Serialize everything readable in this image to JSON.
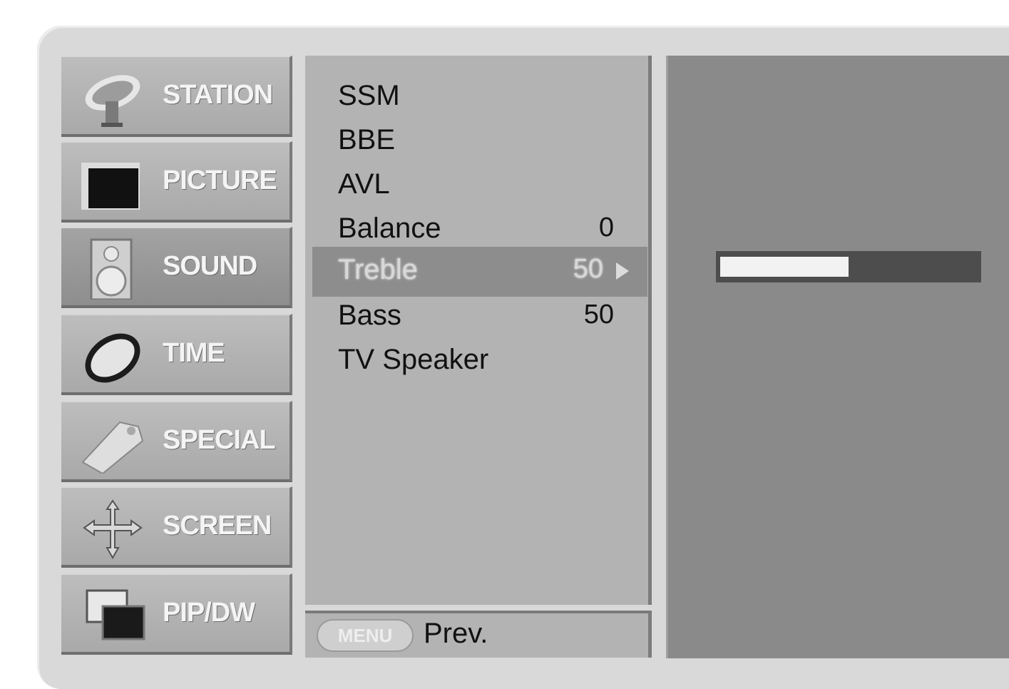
{
  "categories": [
    {
      "label": "STATION",
      "icon": "satellite-dish-icon"
    },
    {
      "label": "PICTURE",
      "icon": "tv-screen-icon"
    },
    {
      "label": "SOUND",
      "icon": "speaker-icon"
    },
    {
      "label": "TIME",
      "icon": "clock-icon"
    },
    {
      "label": "SPECIAL",
      "icon": "special-tag-icon"
    },
    {
      "label": "SCREEN",
      "icon": "move-arrows-icon"
    },
    {
      "label": "PIP/DW",
      "icon": "pip-windows-icon"
    }
  ],
  "active_category": "SOUND",
  "options": [
    {
      "label": "SSM",
      "value": ""
    },
    {
      "label": "BBE",
      "value": ""
    },
    {
      "label": "AVL",
      "value": ""
    },
    {
      "label": "Balance",
      "value": "0"
    },
    {
      "label": "Treble",
      "value": "50"
    },
    {
      "label": "Bass",
      "value": "50"
    },
    {
      "label": "TV Speaker",
      "value": ""
    }
  ],
  "selected_option": "Treble",
  "footer": {
    "button_label": "MENU",
    "prev_label": "Prev."
  },
  "treble_level_percent": 50,
  "colors": {
    "background": "#d9d9d9",
    "selected_row": "#8d8d8d",
    "preview": "#8a8a8a"
  }
}
